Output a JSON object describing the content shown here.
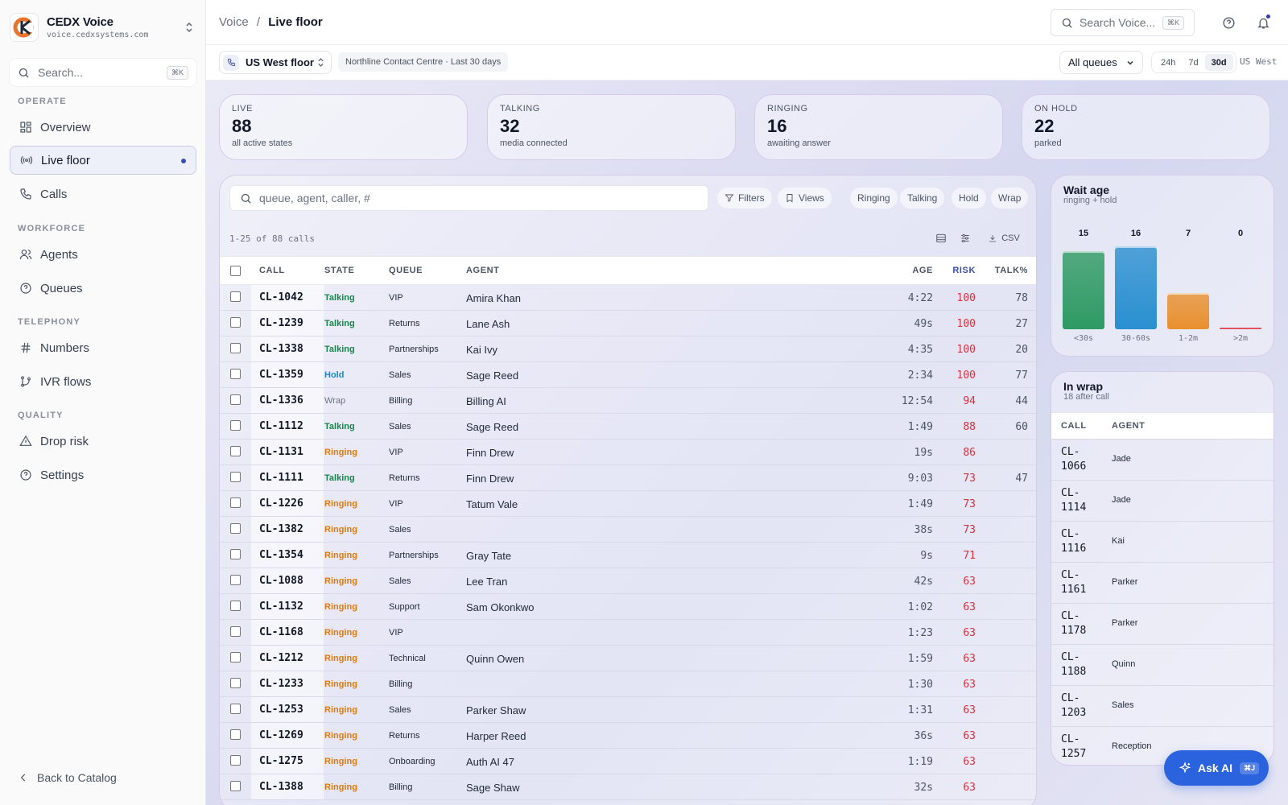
{
  "brand": {
    "name": "CEDX Voice",
    "domain": "voice.cedxsystems.com"
  },
  "sidebar": {
    "search_placeholder": "Search...",
    "search_kbd": "⌘K",
    "sections": {
      "operate": "OPERATE",
      "workforce": "WORKFORCE",
      "telephony": "TELEPHONY",
      "quality": "QUALITY"
    },
    "items": {
      "overview": "Overview",
      "live_floor": "Live floor",
      "calls": "Calls",
      "agents": "Agents",
      "queues": "Queues",
      "numbers": "Numbers",
      "ivr_flows": "IVR flows",
      "drop_risk": "Drop risk",
      "settings": "Settings"
    },
    "back": "Back to Catalog"
  },
  "header": {
    "breadcrumb_root": "Voice",
    "breadcrumb_sep": "/",
    "breadcrumb_current": "Live floor",
    "search_placeholder": "Search Voice...",
    "search_kbd": "⌘K"
  },
  "subbar": {
    "floor": "US West floor",
    "context": "Northline Contact Centre · Last 30 days",
    "queue_filter": "All queues",
    "ranges": [
      "24h",
      "7d",
      "30d"
    ],
    "selected_range": "30d",
    "region": "US West"
  },
  "kpis": [
    {
      "label": "LIVE",
      "value": "88",
      "sub": "all active states"
    },
    {
      "label": "TALKING",
      "value": "32",
      "sub": "media connected"
    },
    {
      "label": "RINGING",
      "value": "16",
      "sub": "awaiting answer"
    },
    {
      "label": "ON HOLD",
      "value": "22",
      "sub": "parked"
    }
  ],
  "table": {
    "search_placeholder": "queue, agent, caller, #",
    "filters_label": "Filters",
    "views_label": "Views",
    "state_chips": [
      "Ringing",
      "Talking",
      "Hold",
      "Wrap"
    ],
    "info": "1-25 of 88 calls",
    "csv_label": "CSV",
    "columns": {
      "call": "CALL",
      "state": "STATE",
      "queue": "QUEUE",
      "agent": "AGENT",
      "age": "AGE",
      "risk": "RISK",
      "talk": "TALK%"
    },
    "rows": [
      {
        "call": "CL-1042",
        "state": "Talking",
        "queue": "VIP",
        "agent": "Amira Khan",
        "age": "4:22",
        "risk": "100",
        "talk": "78"
      },
      {
        "call": "CL-1239",
        "state": "Talking",
        "queue": "Returns",
        "agent": "Lane Ash",
        "age": "49s",
        "risk": "100",
        "talk": "27"
      },
      {
        "call": "CL-1338",
        "state": "Talking",
        "queue": "Partnerships",
        "agent": "Kai Ivy",
        "age": "4:35",
        "risk": "100",
        "talk": "20"
      },
      {
        "call": "CL-1359",
        "state": "Hold",
        "queue": "Sales",
        "agent": "Sage Reed",
        "age": "2:34",
        "risk": "100",
        "talk": "77"
      },
      {
        "call": "CL-1336",
        "state": "Wrap",
        "queue": "Billing",
        "agent": "Billing AI",
        "age": "12:54",
        "risk": "94",
        "talk": "44"
      },
      {
        "call": "CL-1112",
        "state": "Talking",
        "queue": "Sales",
        "agent": "Sage Reed",
        "age": "1:49",
        "risk": "88",
        "talk": "60"
      },
      {
        "call": "CL-1131",
        "state": "Ringing",
        "queue": "VIP",
        "agent": "Finn Drew",
        "age": "19s",
        "risk": "86",
        "talk": ""
      },
      {
        "call": "CL-1111",
        "state": "Talking",
        "queue": "Returns",
        "agent": "Finn Drew",
        "age": "9:03",
        "risk": "73",
        "talk": "47"
      },
      {
        "call": "CL-1226",
        "state": "Ringing",
        "queue": "VIP",
        "agent": "Tatum Vale",
        "age": "1:49",
        "risk": "73",
        "talk": ""
      },
      {
        "call": "CL-1382",
        "state": "Ringing",
        "queue": "Sales",
        "agent": "",
        "age": "38s",
        "risk": "73",
        "talk": ""
      },
      {
        "call": "CL-1354",
        "state": "Ringing",
        "queue": "Partnerships",
        "agent": "Gray Tate",
        "age": "9s",
        "risk": "71",
        "talk": ""
      },
      {
        "call": "CL-1088",
        "state": "Ringing",
        "queue": "Sales",
        "agent": "Lee Tran",
        "age": "42s",
        "risk": "63",
        "talk": ""
      },
      {
        "call": "CL-1132",
        "state": "Ringing",
        "queue": "Support",
        "agent": "Sam Okonkwo",
        "age": "1:02",
        "risk": "63",
        "talk": ""
      },
      {
        "call": "CL-1168",
        "state": "Ringing",
        "queue": "VIP",
        "agent": "",
        "age": "1:23",
        "risk": "63",
        "talk": ""
      },
      {
        "call": "CL-1212",
        "state": "Ringing",
        "queue": "Technical",
        "agent": "Quinn Owen",
        "age": "1:59",
        "risk": "63",
        "talk": ""
      },
      {
        "call": "CL-1233",
        "state": "Ringing",
        "queue": "Billing",
        "agent": "",
        "age": "1:30",
        "risk": "63",
        "talk": ""
      },
      {
        "call": "CL-1253",
        "state": "Ringing",
        "queue": "Sales",
        "agent": "Parker Shaw",
        "age": "1:31",
        "risk": "63",
        "talk": ""
      },
      {
        "call": "CL-1269",
        "state": "Ringing",
        "queue": "Returns",
        "agent": "Harper Reed",
        "age": "36s",
        "risk": "63",
        "talk": ""
      },
      {
        "call": "CL-1275",
        "state": "Ringing",
        "queue": "Onboarding",
        "agent": "Auth AI 47",
        "age": "1:19",
        "risk": "63",
        "talk": ""
      },
      {
        "call": "CL-1388",
        "state": "Ringing",
        "queue": "Billing",
        "agent": "Sage Shaw",
        "age": "32s",
        "risk": "63",
        "talk": ""
      }
    ]
  },
  "wait_age": {
    "title": "Wait age",
    "subtitle": "ringing + hold"
  },
  "chart_data": {
    "type": "bar",
    "categories": [
      "<30s",
      "30-60s",
      "1-2m",
      ">2m"
    ],
    "values": [
      15,
      16,
      7,
      0
    ],
    "colors": [
      "#2e9a63",
      "#2a8fd0",
      "#e8902f",
      "#e05260"
    ],
    "ylim": [
      0,
      16
    ]
  },
  "wrap": {
    "title": "In wrap",
    "subtitle": "18 after call",
    "columns": {
      "call": "CALL",
      "agent": "AGENT"
    },
    "rows": [
      {
        "call": "CL-1066",
        "agent": "Jade"
      },
      {
        "call": "CL-1114",
        "agent": "Jade"
      },
      {
        "call": "CL-1116",
        "agent": "Kai"
      },
      {
        "call": "CL-1161",
        "agent": "Parker"
      },
      {
        "call": "CL-1178",
        "agent": "Parker"
      },
      {
        "call": "CL-1188",
        "agent": "Quinn"
      },
      {
        "call": "CL-1203",
        "agent": "Sales"
      },
      {
        "call": "CL-1257",
        "agent": "Reception"
      }
    ]
  },
  "ask_ai": {
    "label": "Ask AI",
    "kbd": "⌘J"
  }
}
